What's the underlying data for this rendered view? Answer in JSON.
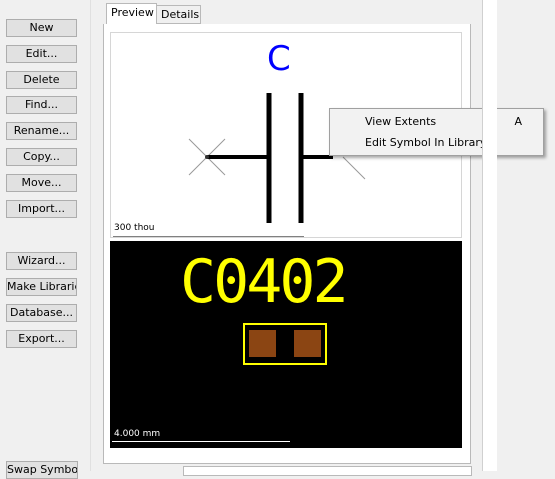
{
  "sidebar": {
    "buttons": [
      {
        "label": "New"
      },
      {
        "label": "Edit..."
      },
      {
        "label": "Delete"
      },
      {
        "label": "Find..."
      },
      {
        "label": "Rename..."
      },
      {
        "label": "Copy..."
      },
      {
        "label": "Move..."
      },
      {
        "label": "Import..."
      },
      {
        "label": "Wizard..."
      },
      {
        "label": "Make Libraries"
      },
      {
        "label": "Database..."
      },
      {
        "label": "Export..."
      }
    ],
    "swap_label": "Swap Symbols"
  },
  "tabs": [
    {
      "label": "Preview",
      "active": true
    },
    {
      "label": "Details",
      "active": false
    }
  ],
  "schematic": {
    "ref_label": "C",
    "scale_label": "300 thou",
    "ref_color": "#0000ff"
  },
  "pcb": {
    "footprint_label": "C0402",
    "scale_label": "4.000 mm",
    "text_color": "#ffff00",
    "pad_color": "#8b4513"
  },
  "context_menu": {
    "items": [
      {
        "label": "View Extents",
        "shortcut": "A"
      },
      {
        "label": "Edit Symbol In Library",
        "shortcut": ""
      }
    ]
  }
}
